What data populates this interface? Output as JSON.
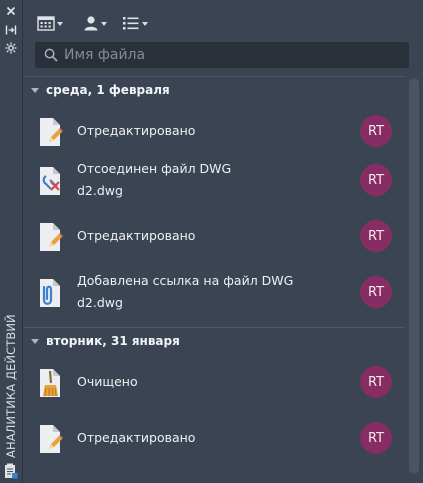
{
  "palette": {
    "background": "#3b4453",
    "search_bg": "#2a303a",
    "avatar_bg": "#862d63",
    "accent_blue": "#3f7fd0",
    "pencil_orange": "#e8a23a"
  },
  "rail": {
    "title": "АНАЛИТИКА ДЕЙСТВИЙ",
    "icons": [
      "close-icon",
      "collapse-icon",
      "settings-icon",
      "palette-properties-icon"
    ]
  },
  "toolbar": {
    "buttons": [
      {
        "icon": "calendar-icon",
        "has_dropdown": true
      },
      {
        "icon": "user-icon",
        "has_dropdown": true
      },
      {
        "icon": "list-icon",
        "has_dropdown": true
      }
    ]
  },
  "search": {
    "placeholder": "Имя файла",
    "value": ""
  },
  "groups": [
    {
      "date": "среда, 1 февраля",
      "items": [
        {
          "icon": "file-edit-icon",
          "title": "Отредактировано",
          "subtitle": "",
          "user": "RT"
        },
        {
          "icon": "file-detach-icon",
          "title": "Отсоединен файл DWG",
          "subtitle": "d2.dwg",
          "user": "RT"
        },
        {
          "icon": "file-edit-icon",
          "title": "Отредактировано",
          "subtitle": "",
          "user": "RT"
        },
        {
          "icon": "file-attach-icon",
          "title": "Добавлена ссылка на файл DWG",
          "subtitle": "d2.dwg",
          "user": "RT"
        }
      ]
    },
    {
      "date": "вторник, 31 января",
      "items": [
        {
          "icon": "file-purge-icon",
          "title": "Очищено",
          "subtitle": "",
          "user": "RT"
        },
        {
          "icon": "file-edit-icon",
          "title": "Отредактировано",
          "subtitle": "",
          "user": "RT"
        }
      ]
    }
  ]
}
